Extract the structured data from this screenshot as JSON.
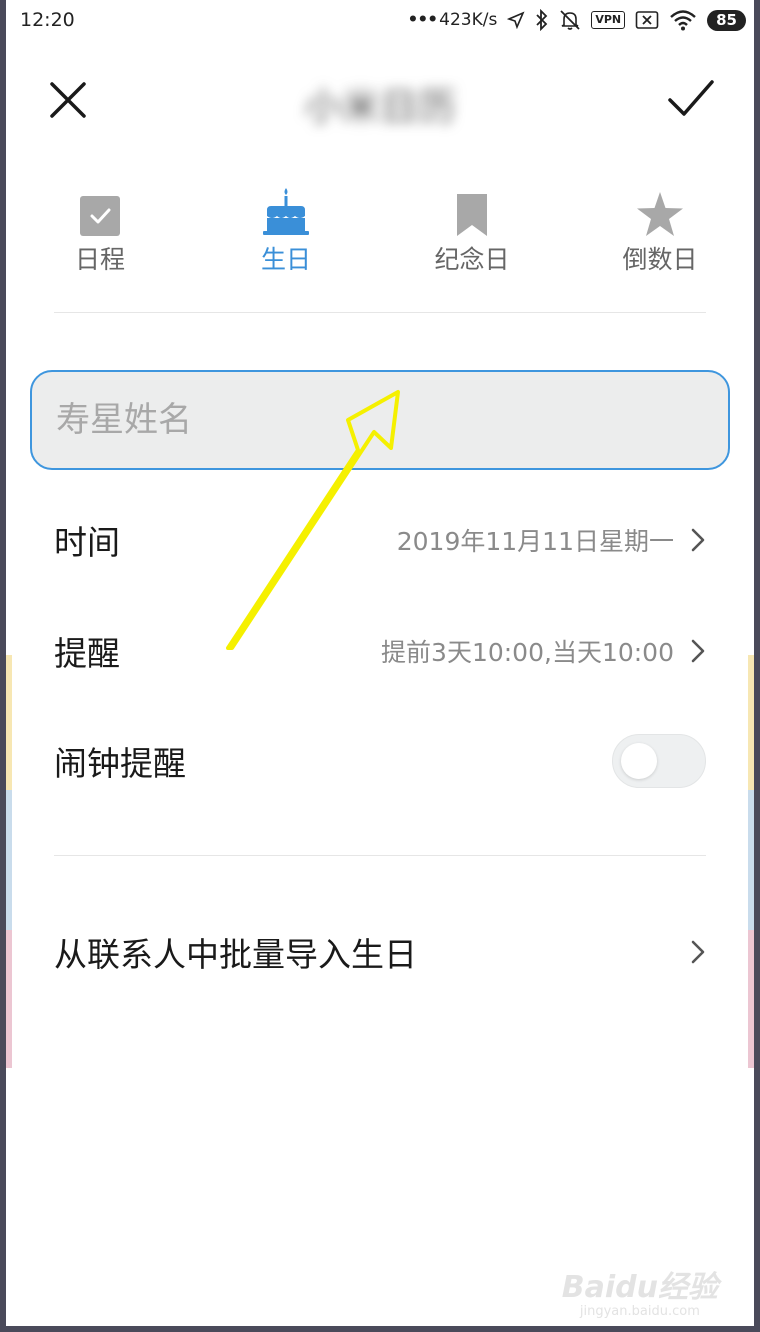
{
  "status_bar": {
    "time": "12:20",
    "network_speed": "423K/s",
    "vpn_label": "VPN",
    "battery": "85"
  },
  "header": {
    "title": "小米日历",
    "close_icon": "close-icon",
    "confirm_icon": "check-icon"
  },
  "tabs": [
    {
      "label": "日程",
      "icon": "checkbox-icon",
      "active": false
    },
    {
      "label": "生日",
      "icon": "birthday-cake-icon",
      "active": true
    },
    {
      "label": "纪念日",
      "icon": "bookmark-icon",
      "active": false
    },
    {
      "label": "倒数日",
      "icon": "star-icon",
      "active": false
    }
  ],
  "form": {
    "name_placeholder": "寿星姓名",
    "name_value": "",
    "time_label": "时间",
    "time_value": "2019年11月11日星期一",
    "reminder_label": "提醒",
    "reminder_value": "提前3天10:00,当天10:00",
    "alarm_label": "闹钟提醒",
    "alarm_enabled": false,
    "import_label": "从联系人中批量导入生日"
  },
  "colors": {
    "accent": "#3a8fd8",
    "input_border": "#3e96de",
    "input_bg": "#eceded",
    "annotation_arrow": "#f5f000"
  },
  "watermark": {
    "main": "Baidu经验",
    "sub": "jingyan.baidu.com"
  }
}
